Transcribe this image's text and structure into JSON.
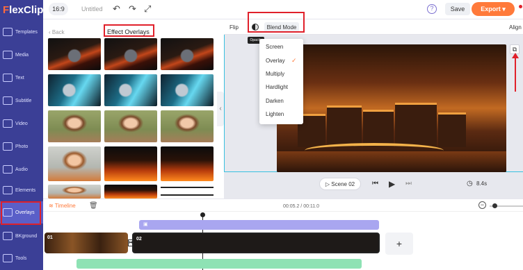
{
  "app": {
    "logo_text": "lexClip",
    "logo_mark": "F"
  },
  "topbar": {
    "aspect": "16:9",
    "title": "Untitled",
    "save": "Save",
    "export": "Export",
    "help": "?"
  },
  "sidebar": {
    "items": [
      {
        "label": "Templates"
      },
      {
        "label": "Media"
      },
      {
        "label": "Text"
      },
      {
        "label": "Subtitle"
      },
      {
        "label": "Video"
      },
      {
        "label": "Photo"
      },
      {
        "label": "Audio"
      },
      {
        "label": "Elements"
      },
      {
        "label": "Overlays"
      },
      {
        "label": "BKground"
      },
      {
        "label": "Tools"
      }
    ]
  },
  "panel": {
    "back": "Back",
    "title": "Effect Overlays"
  },
  "canvas": {
    "flip": "Flip",
    "blend_mode": "Blend Mode",
    "align": "Align",
    "tooltip": "Opacity"
  },
  "dropdown": {
    "items": [
      "Screen",
      "Overlay",
      "Multiply",
      "Hardlight",
      "Darken",
      "Lighten"
    ],
    "selected": "Overlay",
    "check": "✓"
  },
  "controls": {
    "scene": "Scene 02",
    "duration": "8.4s"
  },
  "timeline": {
    "label": "Timeline",
    "time": "00:05.2 / 00:11.0",
    "clip1": "01",
    "clip2": "02",
    "add": "+"
  },
  "colors": {
    "accent": "#ff7a3b",
    "sidebar": "#3b3f96",
    "highlight": "#e0202a"
  }
}
